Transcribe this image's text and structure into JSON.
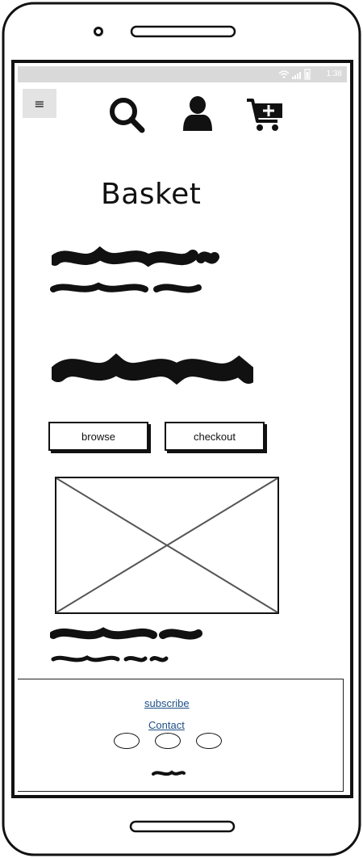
{
  "status_bar": {
    "time": "1:38"
  },
  "menu": {
    "label": "≡"
  },
  "header_icons": [
    "search-icon",
    "user-icon",
    "add-to-cart-icon"
  ],
  "page": {
    "title": "Basket"
  },
  "buttons": {
    "browse": "browse",
    "checkout": "checkout"
  },
  "footer": {
    "subscribe": "subscribe",
    "contact": "Contact",
    "social_count": 3
  },
  "colors": {
    "link": "#1f4f87",
    "statusbar": "#d9d9d9",
    "ink": "#111111"
  }
}
